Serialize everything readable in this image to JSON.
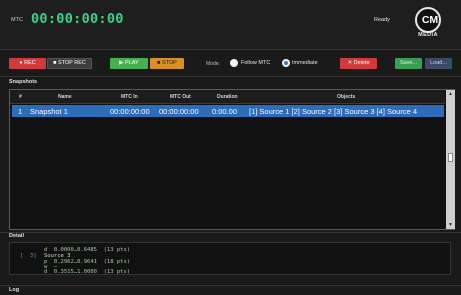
{
  "header": {
    "mtc_label": "MTC",
    "timecode": "00:00:00:00",
    "status": "Ready",
    "logo_text": "CM",
    "logo_sub": "MEDIA"
  },
  "toolbar": {
    "rec_label": "● REC",
    "stop_rec_label": "■ STOP REC",
    "play_label": "▶ PLAY",
    "stop_label": "■ STOP",
    "mode_label": "Mode:",
    "follow_label": "Follow MTC",
    "immediate_label": "Immediate",
    "delete_label": "✕ Delete",
    "save_label": "Save...",
    "load_label": "Load..."
  },
  "snapshots": {
    "title": "Snapshots",
    "columns": [
      "#",
      "Name",
      "MTC In",
      "MTC Out",
      "Duration",
      "Objects"
    ],
    "rows": [
      {
        "index": "1",
        "name": "Snapshot 1",
        "mtc_in": "00:00:00:00",
        "mtc_out": "00:00:00:00",
        "duration": "0:00.00",
        "objects": "[1] Source 1   [2] Source 2   [3] Source 3   [4] Source 4"
      }
    ]
  },
  "detail": {
    "title": "Detail",
    "lines": [
      "d  0.0000…0.6485  (13 pts)",
      "[  3]",
      "Source 3",
      "p  0.2962…0.9641  (18 pts)",
      "w  —",
      "d  0.3515…1.0000  (13 pts)"
    ]
  },
  "log": {
    "title": "Log"
  },
  "colors": {
    "timecode": "#3ad28c",
    "selection": "#2d6cbb",
    "rec": "#cf3b3b",
    "play": "#46b050",
    "stop": "#d99026"
  }
}
